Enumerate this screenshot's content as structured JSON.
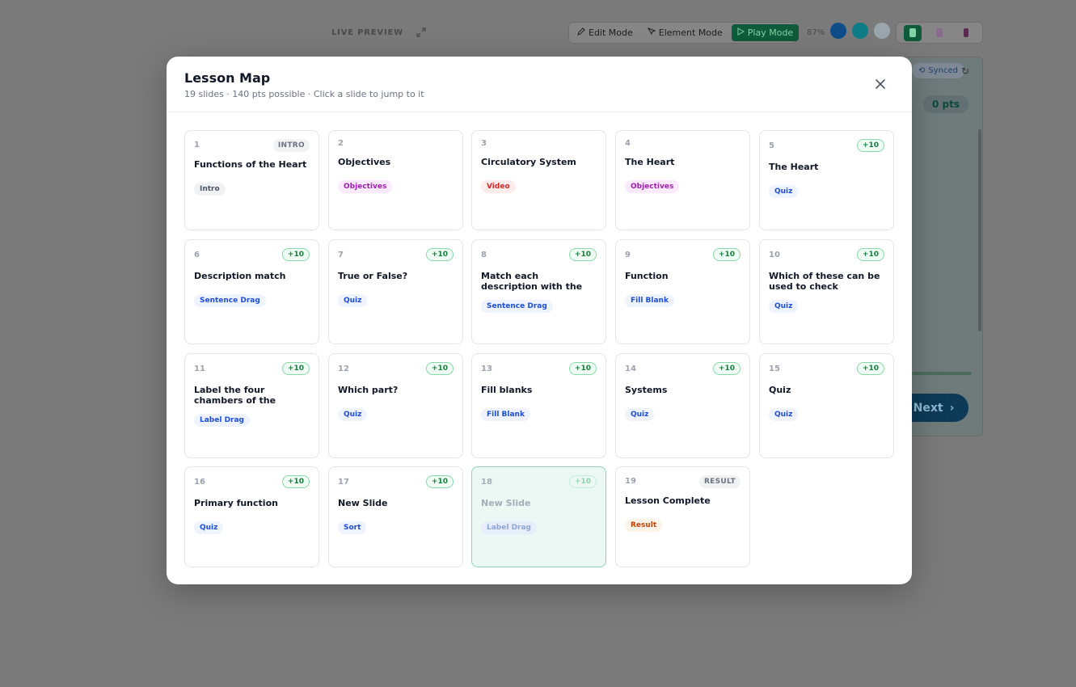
{
  "background": {
    "live_preview_label": "LIVE PREVIEW",
    "modes": [
      {
        "label": "Edit Mode",
        "icon": "pencil-icon",
        "active": false
      },
      {
        "label": "Element Mode",
        "icon": "cursor-icon",
        "active": false
      },
      {
        "label": "Play Mode",
        "icon": "play-icon",
        "active": true
      }
    ],
    "zoom": "87%",
    "colors": {
      "swatch_1": "#0f4c8a",
      "swatch_2": "#0e7c86",
      "swatch_3": "#9aa6ae",
      "accent": "#0f5a3a"
    },
    "synced_label": "Synced",
    "points": "0  pts",
    "next_label": "Next"
  },
  "modal": {
    "title": "Lesson Map",
    "subtitle": "19 slides · 140 pts possible · Click a slide to jump to it",
    "slides": [
      {
        "num": "1",
        "title": "Functions of the Heart",
        "badge": "INTRO",
        "badge_type": "label",
        "tag": "Intro",
        "tag_type": "intro"
      },
      {
        "num": "2",
        "title": "Objectives",
        "badge": "",
        "badge_type": "",
        "tag": "Objectives",
        "tag_type": "objectives"
      },
      {
        "num": "3",
        "title": "Circulatory System",
        "badge": "",
        "badge_type": "",
        "tag": "Video",
        "tag_type": "video"
      },
      {
        "num": "4",
        "title": "The Heart",
        "badge": "",
        "badge_type": "",
        "tag": "Objectives",
        "tag_type": "objectives"
      },
      {
        "num": "5",
        "title": "The Heart",
        "badge": "+10",
        "badge_type": "pts",
        "tag": "Quiz",
        "tag_type": "quiz"
      },
      {
        "num": "6",
        "title": "Description match",
        "badge": "+10",
        "badge_type": "pts",
        "tag": "Sentence Drag",
        "tag_type": "sentence"
      },
      {
        "num": "7",
        "title": "True or False?",
        "badge": "+10",
        "badge_type": "pts",
        "tag": "Quiz",
        "tag_type": "quiz"
      },
      {
        "num": "8",
        "title": "Match each description with the correct part of…",
        "badge": "+10",
        "badge_type": "pts",
        "tag": "Sentence Drag",
        "tag_type": "sentence"
      },
      {
        "num": "9",
        "title": "Function",
        "badge": "+10",
        "badge_type": "pts",
        "tag": "Fill Blank",
        "tag_type": "fill"
      },
      {
        "num": "10",
        "title": "Which of these can be used to check heartbeat?",
        "badge": "+10",
        "badge_type": "pts",
        "tag": "Quiz",
        "tag_type": "quiz"
      },
      {
        "num": "11",
        "title": "Label the four chambers of the human heart…",
        "badge": "+10",
        "badge_type": "pts",
        "tag": "Label Drag",
        "tag_type": "label-drag"
      },
      {
        "num": "12",
        "title": "Which part?",
        "badge": "+10",
        "badge_type": "pts",
        "tag": "Quiz",
        "tag_type": "quiz"
      },
      {
        "num": "13",
        "title": "Fill blanks",
        "badge": "+10",
        "badge_type": "pts",
        "tag": "Fill Blank",
        "tag_type": "fill"
      },
      {
        "num": "14",
        "title": "Systems",
        "badge": "+10",
        "badge_type": "pts",
        "tag": "Quiz",
        "tag_type": "quiz"
      },
      {
        "num": "15",
        "title": "Quiz",
        "badge": "+10",
        "badge_type": "pts",
        "tag": "Quiz",
        "tag_type": "quiz"
      },
      {
        "num": "16",
        "title": "Primary function",
        "badge": "+10",
        "badge_type": "pts",
        "tag": "Quiz",
        "tag_type": "quiz"
      },
      {
        "num": "17",
        "title": "New Slide",
        "badge": "+10",
        "badge_type": "pts",
        "tag": "Sort",
        "tag_type": "sort"
      },
      {
        "num": "18",
        "title": "New Slide",
        "badge": "+10",
        "badge_type": "pts",
        "tag": "Label Drag",
        "tag_type": "label-drag",
        "current": true
      },
      {
        "num": "19",
        "title": "Lesson Complete",
        "badge": "RESULT",
        "badge_type": "label",
        "tag": "Result",
        "tag_type": "result"
      }
    ]
  }
}
